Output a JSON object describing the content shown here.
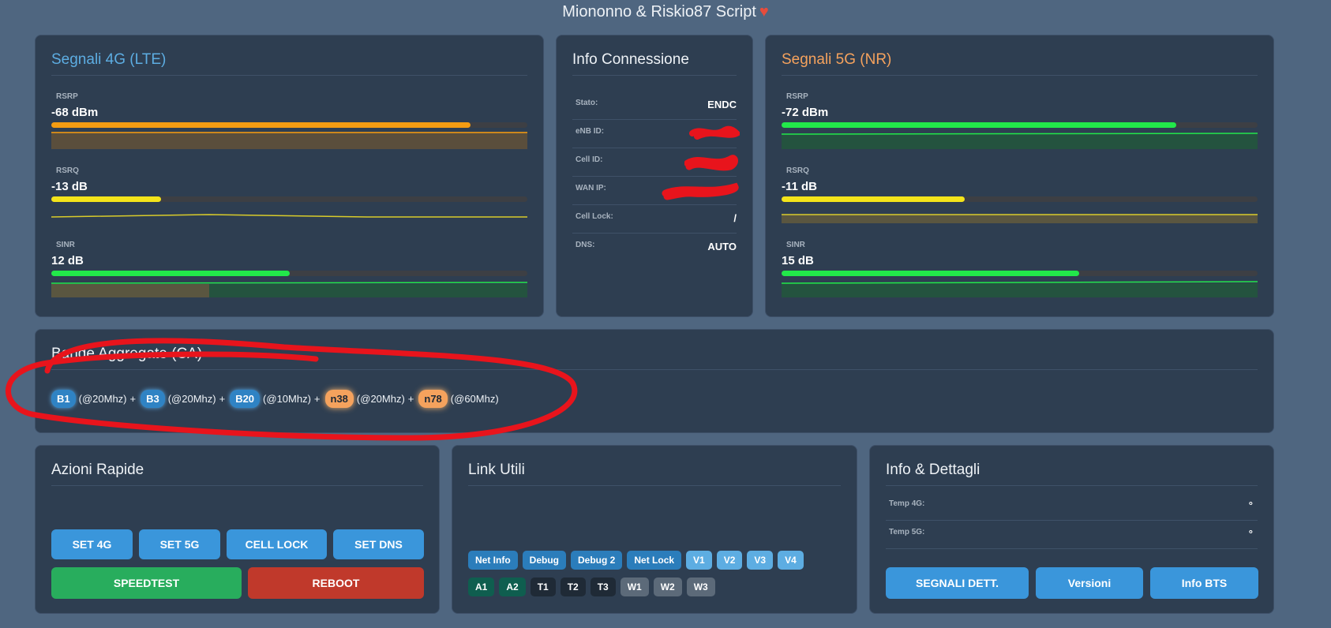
{
  "header": {
    "title": "Miononno & Riskio87 Script"
  },
  "lte": {
    "title": "Segnali 4G (LTE)",
    "rsrp": {
      "label": "RSRP",
      "value": "-68 dBm",
      "fill": 0.88,
      "color": "#f39c12"
    },
    "rsrq": {
      "label": "RSRQ",
      "value": "-13 dB",
      "fill": 0.23,
      "color": "#f4e41a"
    },
    "sinr": {
      "label": "SINR",
      "value": "12 dB",
      "fill": 0.5,
      "color": "#22e84a"
    }
  },
  "conn": {
    "title": "Info Connessione",
    "rows": [
      {
        "key": "Stato:",
        "value": "ENDC"
      },
      {
        "key": "eNB ID:",
        "value": ""
      },
      {
        "key": "Cell ID:",
        "value": ""
      },
      {
        "key": "WAN IP:",
        "value": ""
      },
      {
        "key": "Cell Lock:",
        "value": "/"
      },
      {
        "key": "DNS:",
        "value": "AUTO"
      }
    ]
  },
  "nr": {
    "title": "Segnali 5G (NR)",
    "rsrp": {
      "label": "RSRP",
      "value": "-72 dBm",
      "fill": 0.83,
      "color": "#22e84a"
    },
    "rsrq": {
      "label": "RSRQ",
      "value": "-11 dB",
      "fill": 0.385,
      "color": "#f4e41a"
    },
    "sinr": {
      "label": "SINR",
      "value": "15 dB",
      "fill": 0.625,
      "color": "#22e84a"
    }
  },
  "bands": {
    "title": "Bande Aggregate (CA)",
    "items": [
      {
        "band": "B1",
        "bw": "(@20Mhz)",
        "sep": "+"
      },
      {
        "band": "B3",
        "bw": "(@20Mhz)",
        "sep": "+"
      },
      {
        "band": "B20",
        "bw": "(@10Mhz)",
        "sep": "+"
      },
      {
        "band": "n38",
        "bw": "(@20Mhz)",
        "sep": "+"
      },
      {
        "band": "n78",
        "bw": "(@60Mhz)",
        "sep": ""
      }
    ]
  },
  "actions": {
    "title": "Azioni Rapide",
    "set4g": "SET 4G",
    "set5g": "SET 5G",
    "celllock": "CELL LOCK",
    "setdns": "SET DNS",
    "speedtest": "SPEEDTEST",
    "reboot": "REBOOT"
  },
  "links": {
    "title": "Link Utili",
    "row1": [
      "Net Info",
      "Debug",
      "Debug 2",
      "Net Lock",
      "V1",
      "V2",
      "V3",
      "V4"
    ],
    "row2": [
      "A1",
      "A2",
      "T1",
      "T2",
      "T3",
      "W1",
      "W2",
      "W3"
    ]
  },
  "details": {
    "title": "Info & Dettagli",
    "temp4g_label": "Temp 4G:",
    "temp4g_value": "°",
    "temp5g_label": "Temp 5G:",
    "temp5g_value": "°",
    "segnali": "SEGNALI DETT.",
    "versioni": "Versioni",
    "infobts": "Info BTS"
  }
}
